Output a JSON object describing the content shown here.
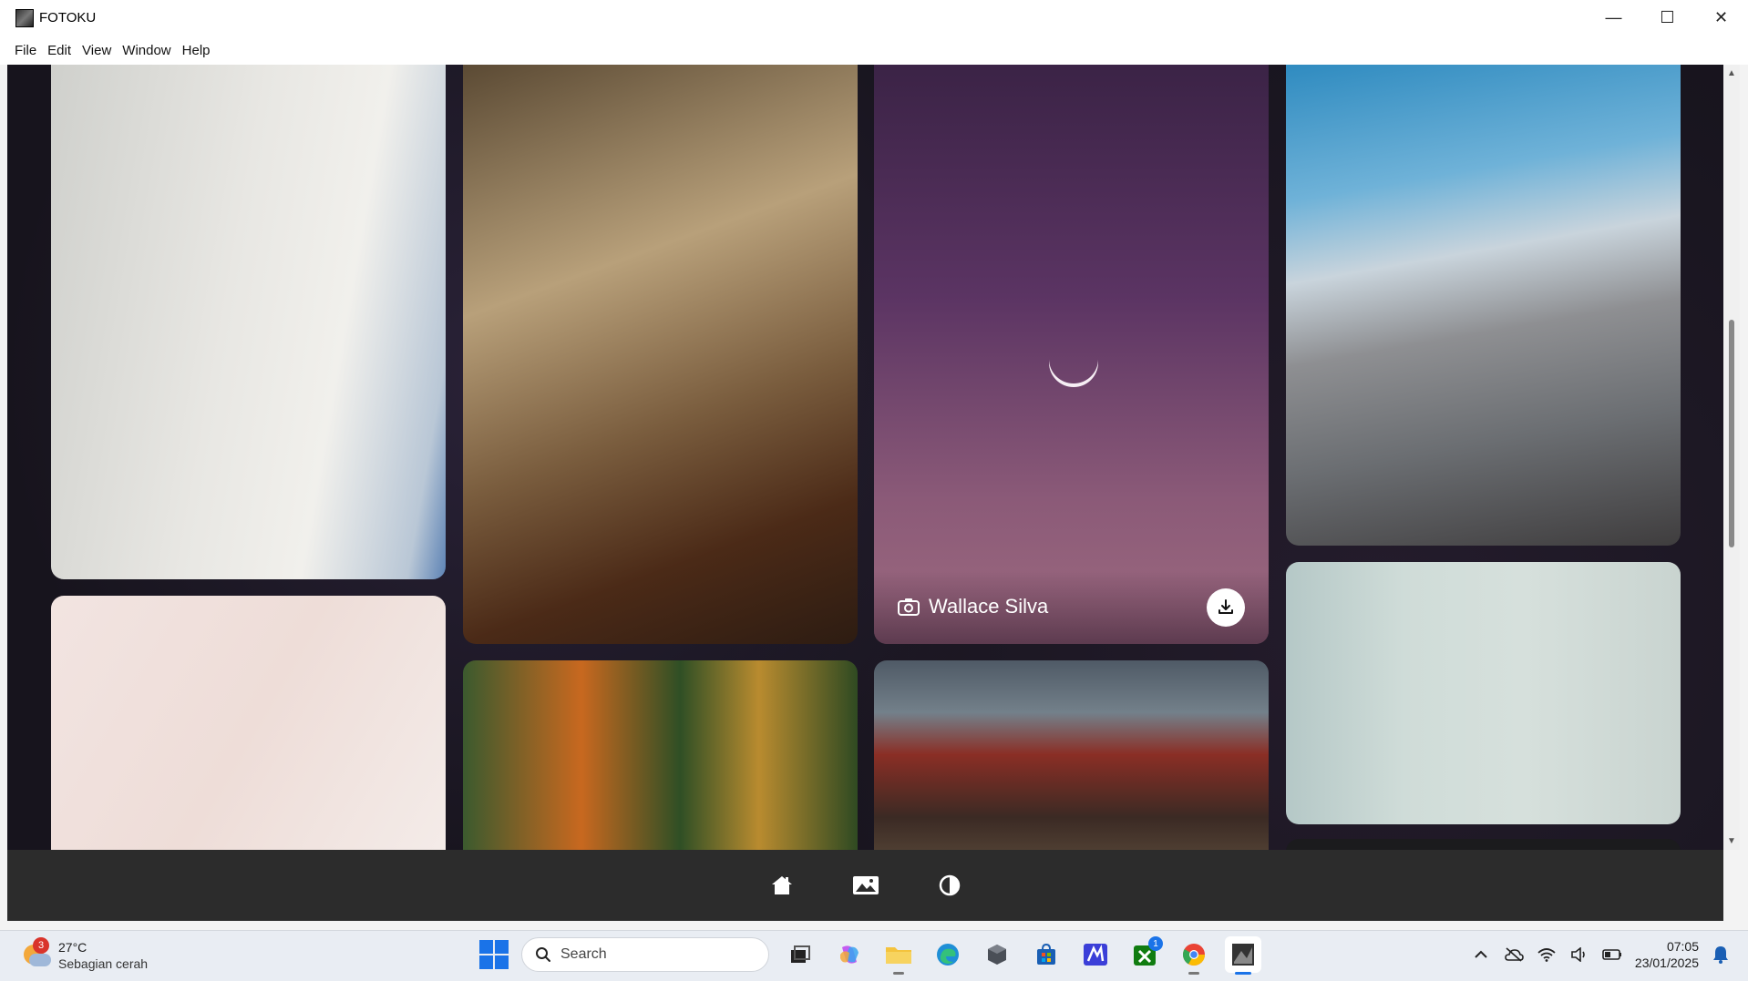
{
  "window": {
    "title": "FOTOKU",
    "minimize": "—",
    "maximize": "☐",
    "close": "✕"
  },
  "menu": [
    "File",
    "Edit",
    "View",
    "Window",
    "Help"
  ],
  "gallery": {
    "photographer": "Wallace Silva"
  },
  "bottom_nav": {
    "icons": [
      "home-icon",
      "gallery-icon",
      "theme-toggle-icon"
    ]
  },
  "taskbar": {
    "weather_temp": "27°C",
    "weather_desc": "Sebagian cerah",
    "weather_badge": "3",
    "search_placeholder": "Search",
    "xbox_badge": "1",
    "time": "07:05",
    "date": "23/01/2025"
  },
  "colors": {
    "accent": "#1a73e8",
    "nav_bg": "#2c2c2c",
    "content_bg": "#17141d"
  }
}
